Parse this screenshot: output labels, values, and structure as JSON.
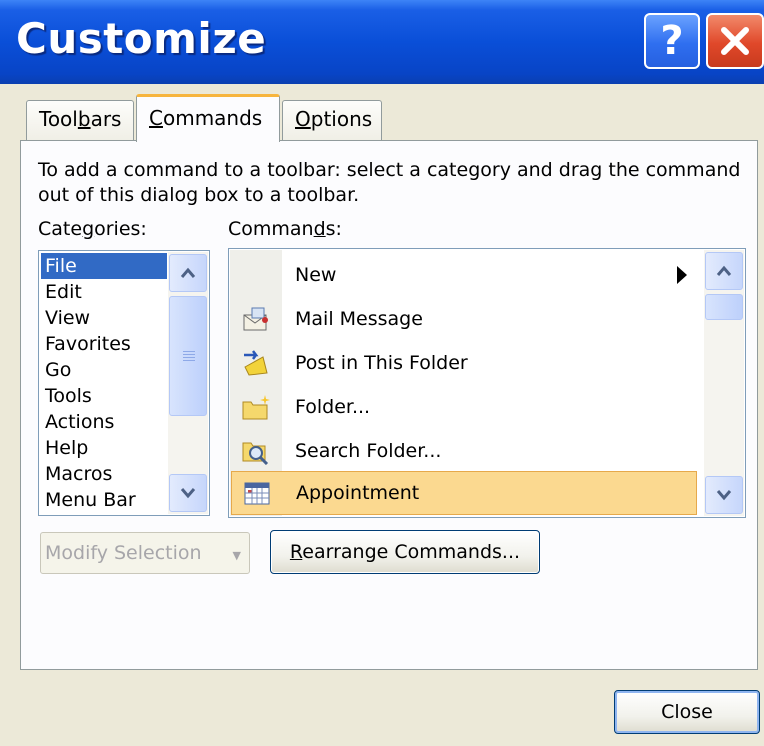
{
  "window": {
    "title": "Customize",
    "help_glyph": "?"
  },
  "tabs": [
    {
      "pre": "Tool",
      "u": "b",
      "post": "ars",
      "label": "Toolbars",
      "active": false
    },
    {
      "pre": "",
      "u": "C",
      "post": "ommands",
      "label": "Commands",
      "active": true
    },
    {
      "pre": "",
      "u": "O",
      "post": "ptions",
      "label": "Options",
      "active": false
    }
  ],
  "panel": {
    "instructions": "To add a command to a toolbar: select a category and drag the command out of this dialog box to a toolbar.",
    "categories_label": {
      "pre": "Cate",
      "u": "g",
      "post": "ories:"
    },
    "commands_label": {
      "pre": "Comman",
      "u": "d",
      "post": "s:"
    },
    "categories": [
      "File",
      "Edit",
      "View",
      "Favorites",
      "Go",
      "Tools",
      "Actions",
      "Help",
      "Macros",
      "Menu Bar"
    ],
    "selected_category": "File",
    "commands": [
      {
        "label": "New",
        "icon": "none",
        "submenu": true
      },
      {
        "label": "Mail Message",
        "icon": "mail-message-icon"
      },
      {
        "label": "Post in This Folder",
        "icon": "post-icon"
      },
      {
        "label": "Folder...",
        "icon": "new-folder-icon"
      },
      {
        "label": "Search Folder...",
        "icon": "search-folder-icon"
      },
      {
        "label": "Appointment",
        "icon": "calendar-icon",
        "selected": true
      }
    ],
    "modify_selection": "Modify Selection",
    "rearrange": {
      "pre": "",
      "u": "R",
      "post": "earrange Commands..."
    }
  },
  "footer": {
    "close_label": "Close"
  }
}
